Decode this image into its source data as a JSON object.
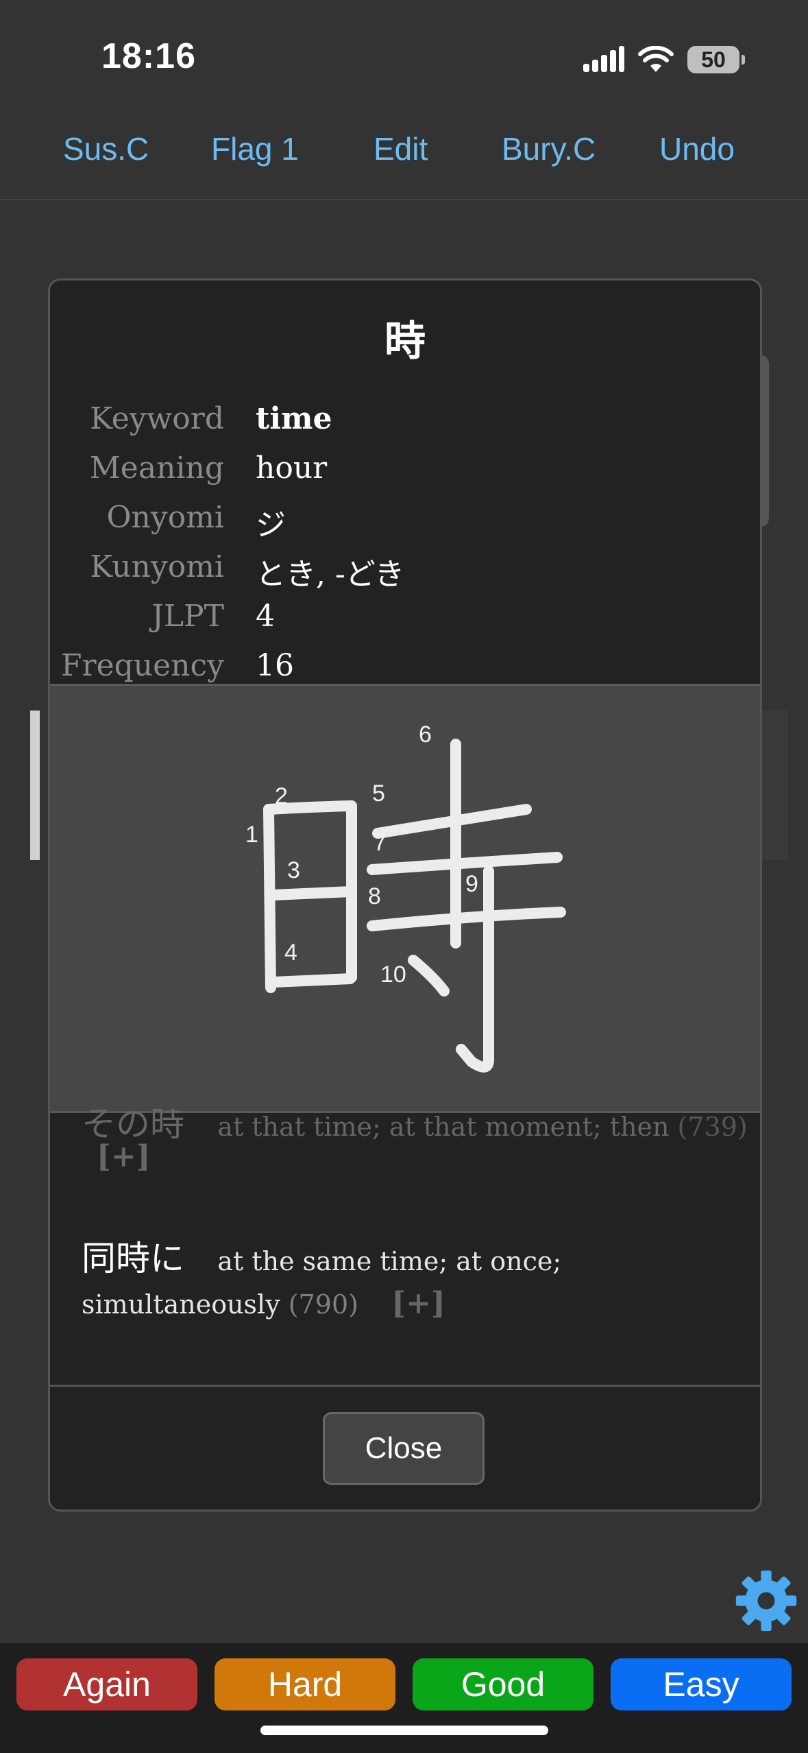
{
  "status_bar": {
    "time": "18:16",
    "battery": "50"
  },
  "toolbar": {
    "buttons": [
      "Sus.C",
      "Flag 1",
      "Edit",
      "Bury.C",
      "Undo"
    ]
  },
  "card": {
    "kanji": "時",
    "fields": [
      {
        "label": "Keyword",
        "value": "time"
      },
      {
        "label": "Meaning",
        "value": "hour"
      },
      {
        "label": "Onyomi",
        "value": "ジ"
      },
      {
        "label": "Kunyomi",
        "value": "とき, -どき"
      },
      {
        "label": "JLPT",
        "value": "4"
      },
      {
        "label": "Frequency",
        "value": "16"
      }
    ],
    "stroke_numbers": [
      "1",
      "2",
      "3",
      "4",
      "5",
      "6",
      "7",
      "8",
      "9",
      "10"
    ],
    "words": [
      {
        "word": "その時",
        "meaning": "at that time; at that moment; then",
        "rank": "(739)",
        "expand": "[+]"
      },
      {
        "word": "同時に",
        "meaning_a": "at the same time; at once;",
        "meaning_b": "simultaneously",
        "rank": "(790)",
        "expand": "[+]"
      }
    ],
    "close_label": "Close"
  },
  "answer_buttons": {
    "again": {
      "label": "Again",
      "color": "#b23232"
    },
    "hard": {
      "label": "Hard",
      "color": "#d0780a"
    },
    "good": {
      "label": "Good",
      "color": "#0aa61a"
    },
    "easy": {
      "label": "Easy",
      "color": "#0a6ef5"
    }
  },
  "icons": {
    "settings": "gear-icon",
    "signal": "cellular-signal-icon",
    "wifi": "wifi-icon",
    "battery": "battery-icon"
  }
}
